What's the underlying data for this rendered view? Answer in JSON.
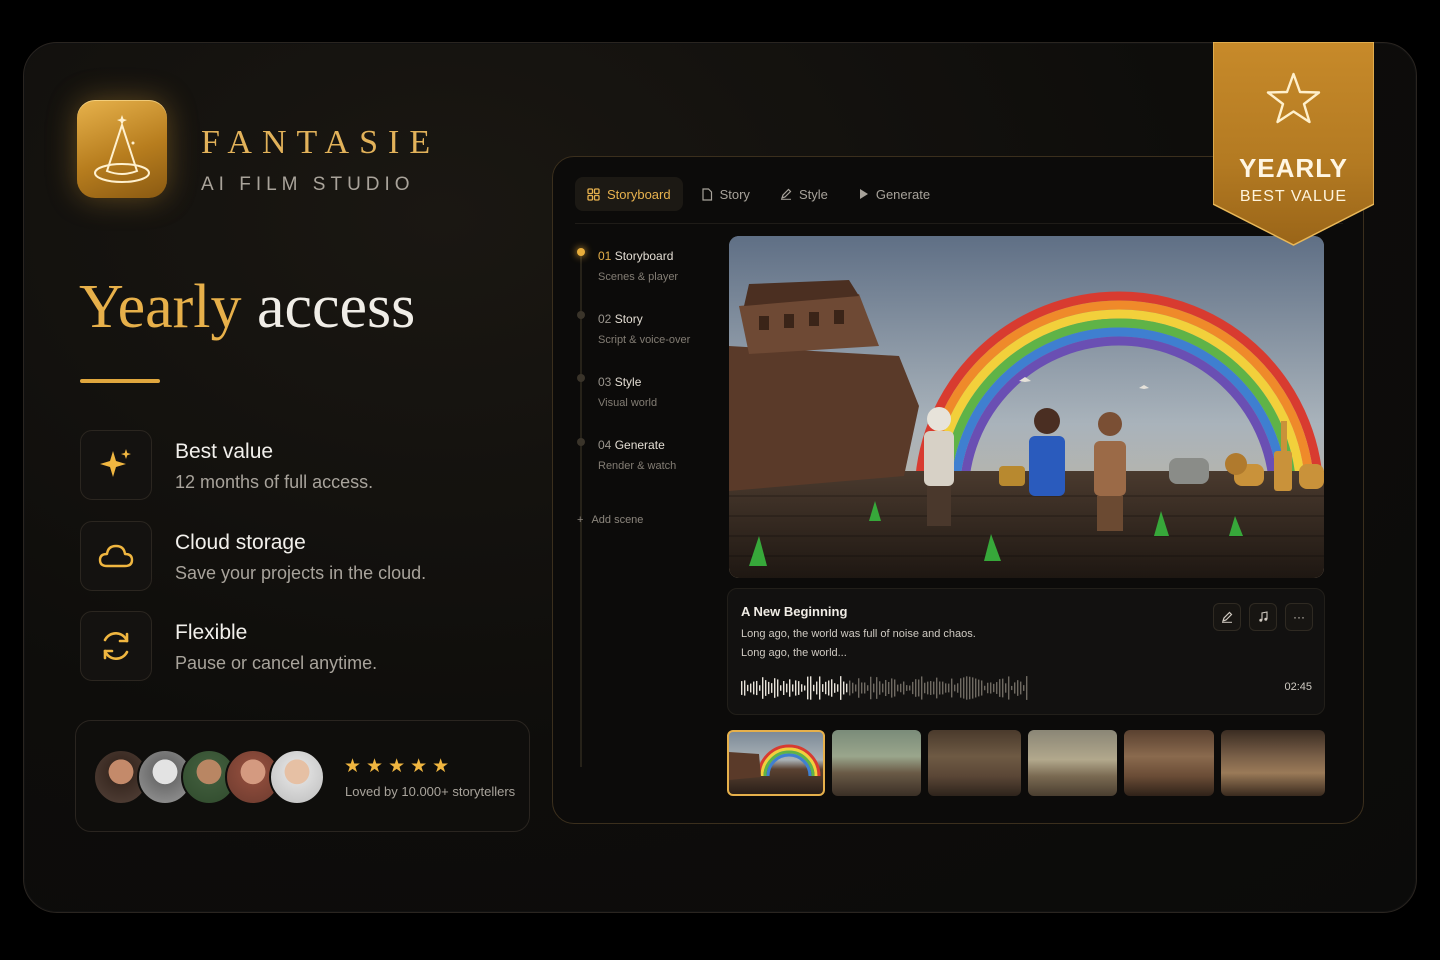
{
  "brand": {
    "name": "FANTASIE",
    "tagline": "AI FILM STUDIO"
  },
  "headline": {
    "highlight": "Yearly",
    "rest": "access"
  },
  "features": [
    {
      "icon": "sparkle-icon",
      "title": "Best value",
      "desc": "12 months of full access."
    },
    {
      "icon": "cloud-icon",
      "title": "Cloud storage",
      "desc": "Save your projects in the cloud."
    },
    {
      "icon": "refresh-icon",
      "title": "Flexible",
      "desc": "Pause or cancel anytime."
    }
  ],
  "social": {
    "stars": "★★★★★",
    "rating": 5,
    "loved": "Loved by 10.000+ storytellers"
  },
  "ribbon": {
    "title": "YEARLY",
    "subtitle": "BEST VALUE"
  },
  "tabs": [
    {
      "label": "Storyboard",
      "icon": "grid-icon",
      "active": true
    },
    {
      "label": "Story",
      "icon": "document-icon",
      "active": false
    },
    {
      "label": "Style",
      "icon": "pen-icon",
      "active": false
    },
    {
      "label": "Generate",
      "icon": "play-icon",
      "active": false
    }
  ],
  "steps": [
    {
      "num": "01",
      "title": "Storyboard",
      "subtitle": "Scenes & player",
      "active": true
    },
    {
      "num": "02",
      "title": "Story",
      "subtitle": "Script & voice-over",
      "active": false
    },
    {
      "num": "03",
      "title": "Style",
      "subtitle": "Visual world",
      "active": false
    },
    {
      "num": "04",
      "title": "Generate",
      "subtitle": "Render & watch",
      "active": false
    }
  ],
  "add_scene": "Add scene",
  "scene": {
    "title": "A New Beginning",
    "line1": "Long ago, the world was full of noise and chaos.",
    "line2": "Long ago, the world...",
    "duration": "02:45"
  },
  "thumbnails": 6,
  "colors": {
    "accent": "#e6b04b",
    "background": "#0c0b0a"
  }
}
